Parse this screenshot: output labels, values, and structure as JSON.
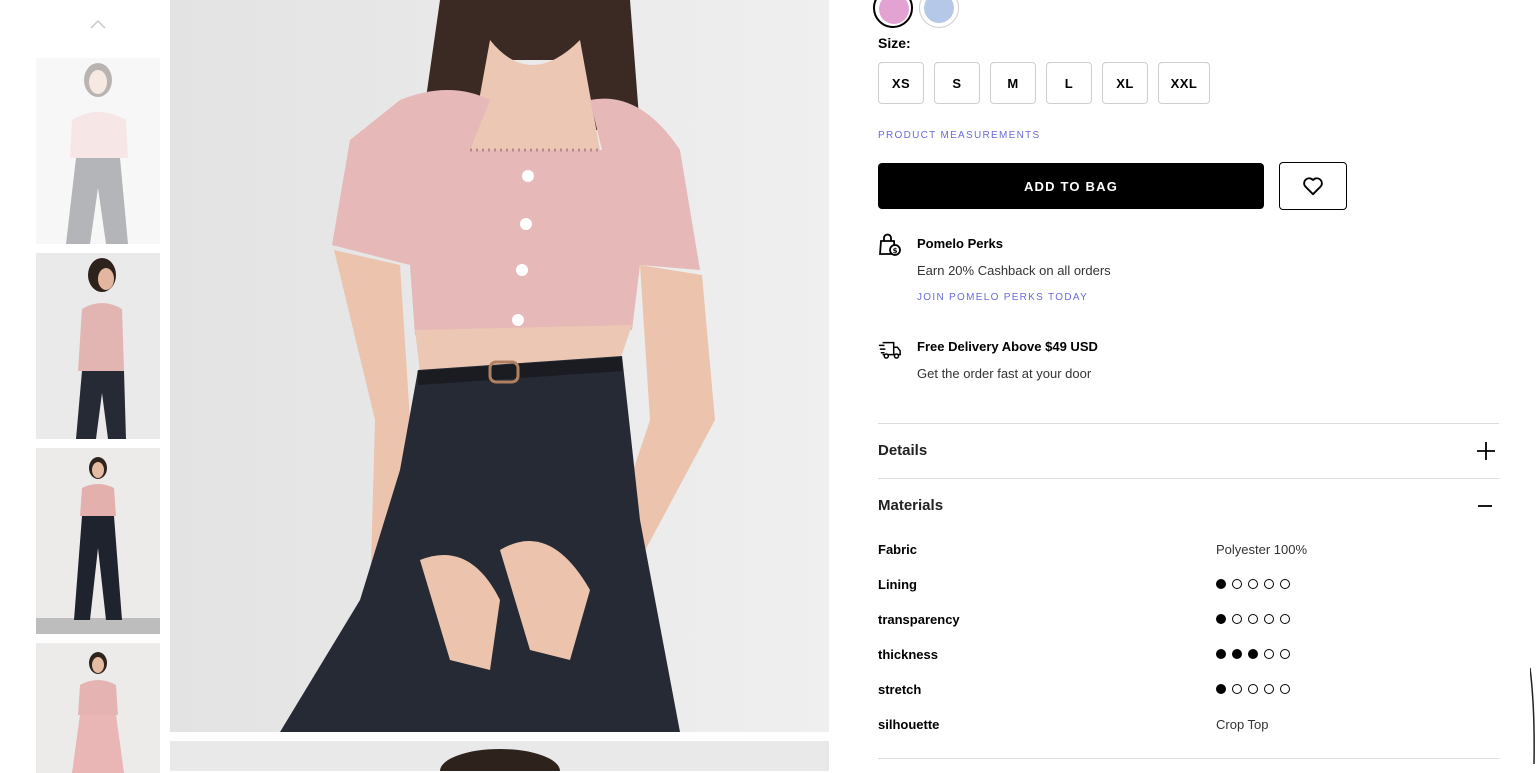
{
  "thumbnails": [
    "thumbnail-front-faded",
    "thumbnail-back",
    "thumbnail-full-front",
    "thumbnail-full-set"
  ],
  "colors": {
    "swatches": [
      {
        "name": "pink",
        "hex": "#e2a3d3",
        "selected": true
      },
      {
        "name": "light blue",
        "hex": "#b6c8e8",
        "selected": false
      }
    ],
    "accent_link": "#6b6bd9"
  },
  "size": {
    "label": "Size:",
    "options": [
      "XS",
      "S",
      "M",
      "L",
      "XL",
      "XXL"
    ]
  },
  "measurements_link": "PRODUCT MEASUREMENTS",
  "add_to_bag": "ADD TO BAG",
  "wishlist_icon": "heart-icon",
  "perks": {
    "icon": "shopping-bag-icon",
    "title": "Pomelo Perks",
    "text": "Earn 20% Cashback on all orders",
    "link": "JOIN POMELO PERKS TODAY"
  },
  "delivery": {
    "icon": "delivery-truck-icon",
    "title": "Free Delivery Above $49 USD",
    "text": "Get the order fast at your door"
  },
  "accordions": {
    "details": {
      "title": "Details",
      "icon": "plus-icon",
      "expanded": false
    },
    "materials": {
      "title": "Materials",
      "icon": "minus-icon",
      "expanded": true
    }
  },
  "materials": {
    "fabric": {
      "label": "Fabric",
      "value": "Polyester 100%"
    },
    "lining": {
      "label": "Lining",
      "level": 1,
      "max": 5
    },
    "transparency": {
      "label": "transparency",
      "level": 1,
      "max": 5
    },
    "thickness": {
      "label": "thickness",
      "level": 3,
      "max": 5
    },
    "stretch": {
      "label": "stretch",
      "level": 1,
      "max": 5
    },
    "silhouette": {
      "label": "silhouette",
      "value": "Crop Top"
    }
  }
}
